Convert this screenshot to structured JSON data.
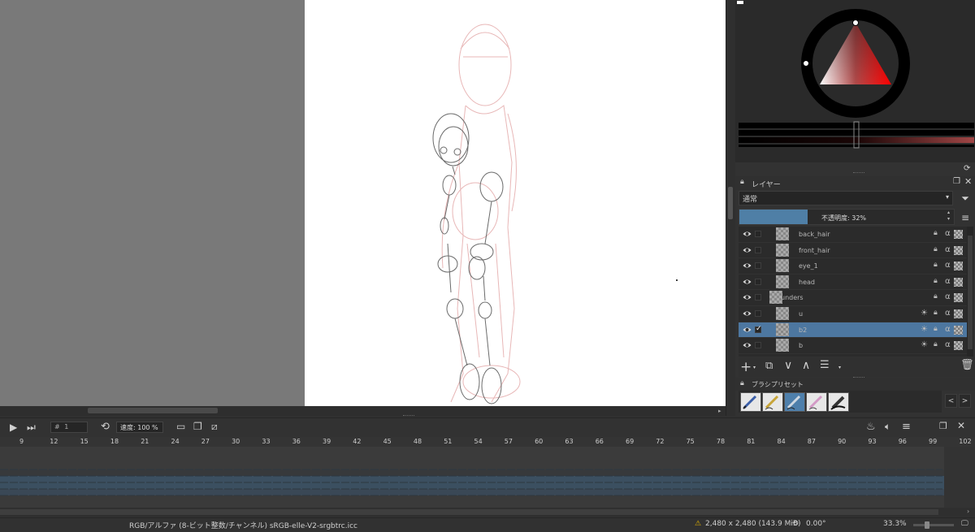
{
  "colors": {
    "accent": "#4f7fa6",
    "selected_layer": "#4d77a0",
    "canvas_bg": "#797979",
    "panel_bg": "#323232",
    "hue_color": "#ff0000"
  },
  "layers_panel": {
    "title": "レイヤー",
    "blend_mode": "通常",
    "opacity_label": "不透明度: 32%",
    "opacity_value": 0.32,
    "rows": [
      {
        "name": "back_hair",
        "alpha": "α",
        "selected": false
      },
      {
        "name": "front_hair",
        "alpha": "α",
        "selected": false
      },
      {
        "name": "eye_1",
        "alpha": "α",
        "selected": false
      },
      {
        "name": "head",
        "alpha": "α",
        "selected": false
      },
      {
        "name": "unders",
        "alpha": "α",
        "selected": false
      },
      {
        "name": "u",
        "alpha": "α",
        "selected": false
      },
      {
        "name": "b2",
        "alpha": "α",
        "selected": true
      },
      {
        "name": "b",
        "alpha": "α",
        "selected": false
      }
    ]
  },
  "brush_panel": {
    "title": "ブラシプリセット",
    "prev": "<",
    "next": ">"
  },
  "animation": {
    "frame_number": "1",
    "frame_hash": "#",
    "speed_label": "速度: 100 %",
    "ruler_ticks": [
      "9",
      "12",
      "15",
      "18",
      "21",
      "24",
      "27",
      "30",
      "33",
      "36",
      "39",
      "42",
      "45",
      "48",
      "51",
      "54",
      "57",
      "60",
      "63",
      "66",
      "69",
      "72",
      "75",
      "78",
      "81",
      "84",
      "87",
      "90",
      "93",
      "96",
      "99",
      "102"
    ]
  },
  "status_bar": {
    "color_profile": "RGB/アルファ (8-ビット整数/チャンネル)  sRGB-elle-V2-srgbtrc.icc",
    "image_size": "2,480 x 2,480 (143.9 MiB)",
    "rotation": "0.00°",
    "zoom": "33.3%",
    "zoom_fraction": 0.33
  },
  "icons": {
    "eye": "eye-icon",
    "lock": "lock-icon",
    "alpha": "alpha-lock-icon",
    "play": "play-icon",
    "next": "next-frame-icon",
    "add": "add-layer-icon",
    "delete": "trash-icon"
  }
}
